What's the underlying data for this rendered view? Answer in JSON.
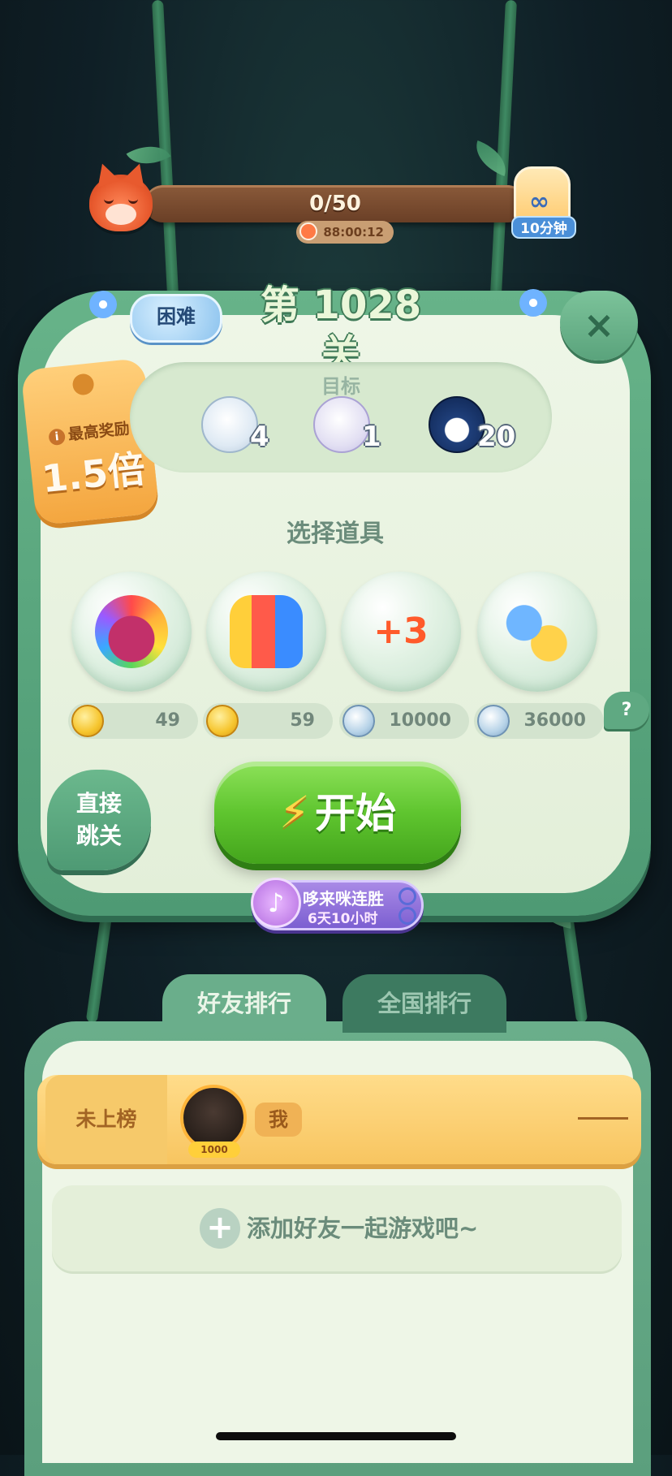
{
  "progress": {
    "value_text": "0/50",
    "timer": "88:00:12"
  },
  "booster": {
    "label": "10分钟",
    "icon": "infinity-icon"
  },
  "level": {
    "difficulty": "困难",
    "title": "第 1028 关"
  },
  "reward": {
    "label": "最高奖励",
    "multiplier": "1.5倍"
  },
  "goals": {
    "title": "目标",
    "items": [
      {
        "name": "polar-bear",
        "count": "4"
      },
      {
        "name": "seal",
        "count": "1"
      },
      {
        "name": "penguin",
        "count": "20"
      }
    ]
  },
  "props": {
    "title": "选择道具",
    "items": [
      {
        "name": "rainbow-owl",
        "price": "49",
        "currency": "gold"
      },
      {
        "name": "rockets",
        "price": "59",
        "currency": "gold"
      },
      {
        "name": "plus-three-moves",
        "price": "10000",
        "currency": "silver"
      },
      {
        "name": "swap-animals",
        "price": "36000",
        "currency": "silver"
      }
    ]
  },
  "buttons": {
    "skip": [
      "直接",
      "跳关"
    ],
    "start": "开始",
    "close": "×",
    "help": "?"
  },
  "streak": {
    "title": "哆来咪连胜",
    "time": "6天10小时"
  },
  "ranking": {
    "tabs": [
      "好友排行",
      "全国排行"
    ],
    "me": {
      "rank": "未上榜",
      "name": "我",
      "level": "1000",
      "score": "——"
    },
    "add_friends": "添加好友一起游戏吧~"
  },
  "colors": {
    "accent_green": "#5fc52f",
    "frame_green": "#4e9a74",
    "reward_orange": "#f4a63f",
    "row_gold": "#f8c560"
  }
}
